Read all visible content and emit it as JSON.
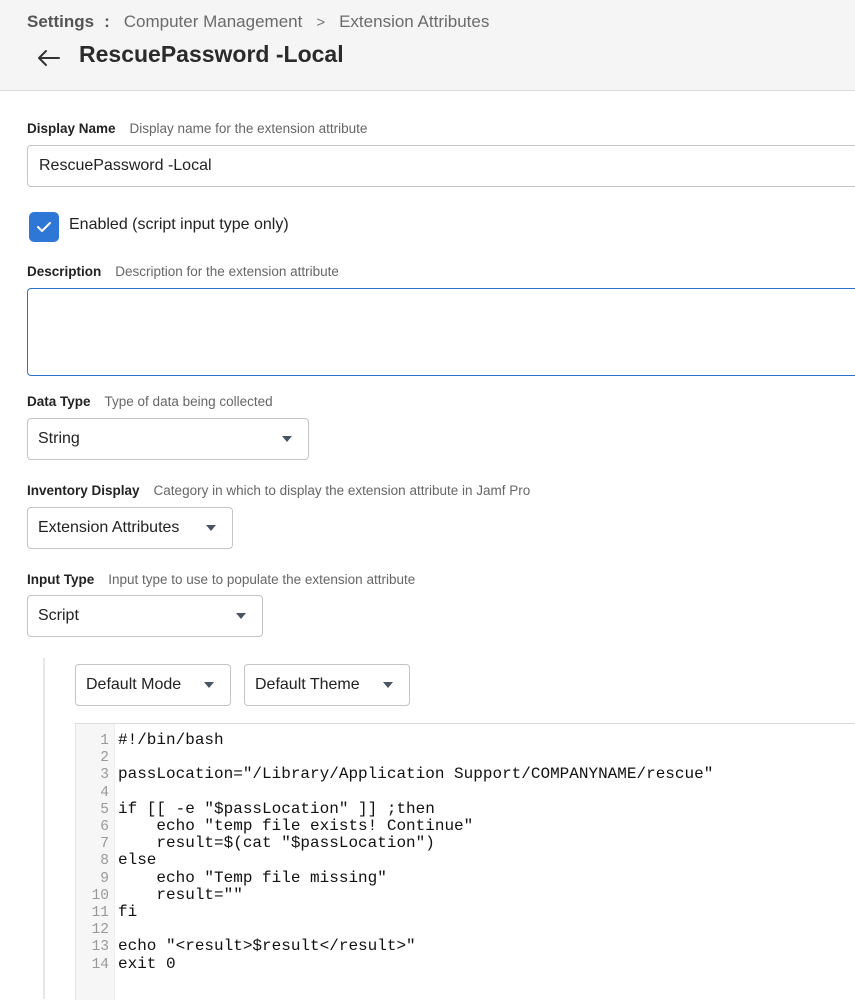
{
  "breadcrumb": {
    "root": "Settings",
    "separator": ":",
    "section": "Computer Management",
    "page": "Extension Attributes"
  },
  "page_title": "RescuePassword -Local",
  "fields": {
    "display_name": {
      "label": "Display Name",
      "hint": "Display name for the extension attribute",
      "value": "RescuePassword -Local"
    },
    "enabled": {
      "label": "Enabled (script input type only)",
      "checked": true
    },
    "description": {
      "label": "Description",
      "hint": "Description for the extension attribute",
      "value": ""
    },
    "data_type": {
      "label": "Data Type",
      "hint": "Type of data being collected",
      "value": "String"
    },
    "inventory_display": {
      "label": "Inventory Display",
      "hint": "Category in which to display the extension attribute in Jamf Pro",
      "value": "Extension Attributes"
    },
    "input_type": {
      "label": "Input Type",
      "hint": "Input type to use to populate the extension attribute",
      "value": "Script"
    }
  },
  "editor": {
    "mode": "Default Mode",
    "theme": "Default Theme",
    "lines": [
      {
        "n": "1",
        "text": "#!/bin/bash"
      },
      {
        "n": "2",
        "text": ""
      },
      {
        "n": "3",
        "text": "passLocation=\"/Library/Application Support/COMPANYNAME/rescue\""
      },
      {
        "n": "4",
        "text": ""
      },
      {
        "n": "5",
        "text": "if [[ -e \"$passLocation\" ]] ;then"
      },
      {
        "n": "6",
        "text": "    echo \"temp file exists! Continue\""
      },
      {
        "n": "7",
        "text": "    result=$(cat \"$passLocation\")"
      },
      {
        "n": "8",
        "text": "else"
      },
      {
        "n": "9",
        "text": "    echo \"Temp file missing\""
      },
      {
        "n": "10",
        "text": "    result=\"\""
      },
      {
        "n": "11",
        "text": "fi"
      },
      {
        "n": "12",
        "text": ""
      },
      {
        "n": "13",
        "text": "echo \"<result>$result</result>\""
      },
      {
        "n": "14",
        "text": "exit 0"
      }
    ]
  },
  "colors": {
    "accent": "#2f77d6",
    "header_bg": "#f5f5f6",
    "focus_border": "#2a75c9"
  },
  "icons": {
    "back": "arrow-left-icon",
    "checkbox": "checkmark-icon",
    "dropdown": "caret-down-icon"
  }
}
